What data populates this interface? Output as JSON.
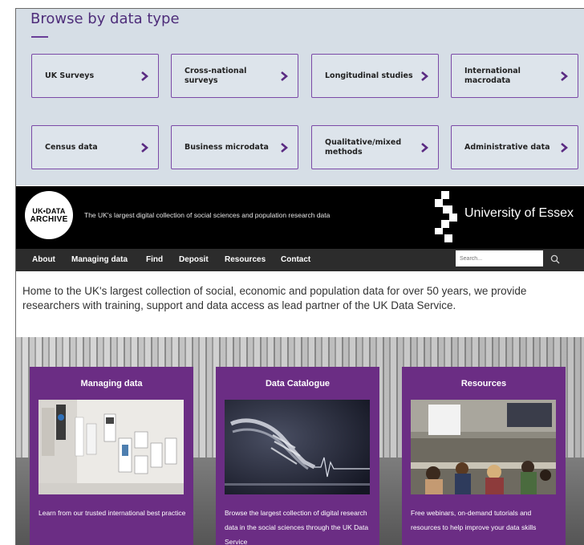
{
  "browse": {
    "title": "Browse by data type",
    "tiles": [
      {
        "label": "UK Surveys"
      },
      {
        "label": "Cross-national surveys"
      },
      {
        "label": "Longitudinal studies"
      },
      {
        "label": "International macrodata"
      },
      {
        "label": "Census data"
      },
      {
        "label": "Business microdata"
      },
      {
        "label": "Qualitative/mixed methods"
      },
      {
        "label": "Administrative data"
      }
    ]
  },
  "header": {
    "logo_line1": "UK•DATA",
    "logo_line2": "ARCHIVE",
    "tagline": "The UK's largest digital collection of social sciences and population research data",
    "university": "University of Essex"
  },
  "nav": {
    "items": [
      "About",
      "Managing data",
      "Find",
      "Deposit",
      "Resources",
      "Contact"
    ],
    "search_placeholder": "Search..."
  },
  "intro": "Home to the UK's largest collection of social, economic and population data for over 50 years, we provide researchers with training, support and data access as lead partner of the UK Data Service.",
  "cards": [
    {
      "title": "Managing data",
      "text": "Learn from our trusted international best practice"
    },
    {
      "title": "Data Catalogue",
      "text": "Browse the largest collection of digital research data in the social sciences through the UK Data Service"
    },
    {
      "title": "Resources",
      "text": "Free webinars, on-demand tutorials and resources to help improve your data skills"
    }
  ],
  "colors": {
    "purple": "#6b2d84",
    "tile_border": "#7b4aa7",
    "browse_bg": "#d6dee6",
    "header_bg": "#000000",
    "nav_bg": "#2c2c2c"
  }
}
